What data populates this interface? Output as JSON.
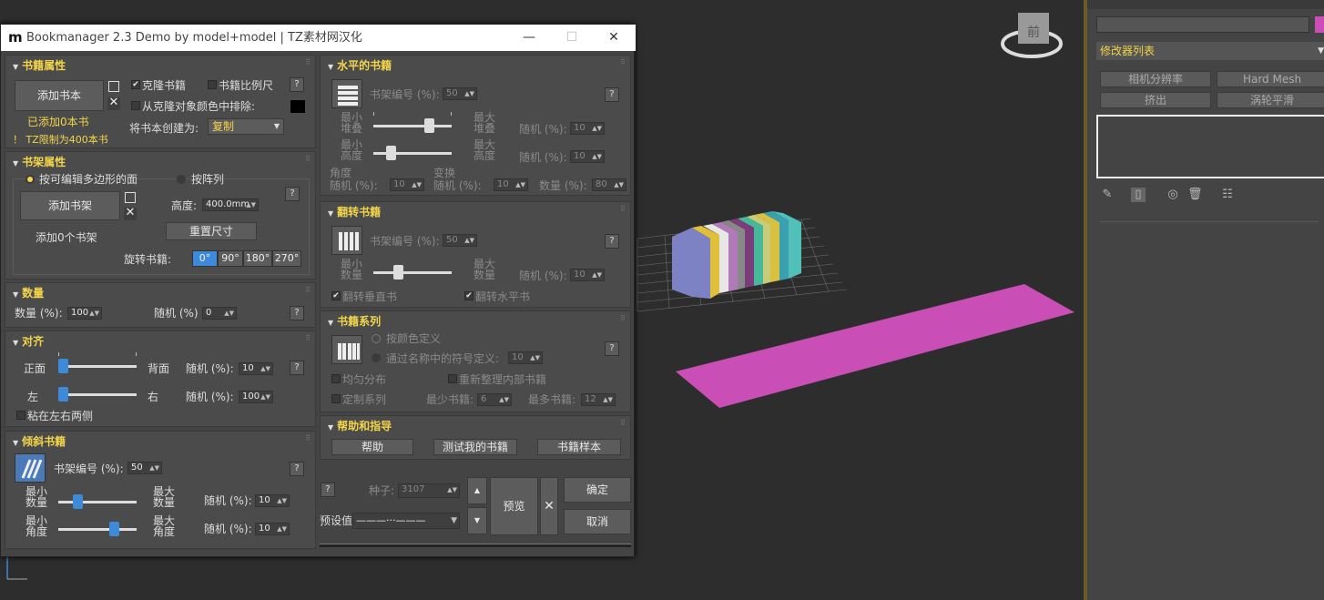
{
  "viewport": {
    "cube_label": "前",
    "plane_color": "#c94fb6"
  },
  "right_panel": {
    "modifier_list": "修改器列表",
    "buttons": [
      "相机分辨率",
      "Hard Mesh",
      "挤出",
      "涡轮平滑"
    ]
  },
  "dialog": {
    "app_icon": "m",
    "title": "Bookmanager 2.3 Demo by model+model | TZ素材网汉化",
    "book_props": {
      "title": "书籍属性",
      "add_book": "添加书本",
      "added": "已添加0本书",
      "limit": "！ TZ限制为400本书",
      "clone": "克隆书籍",
      "proportional": "书籍比例尺",
      "exclude_color": "从克隆对象颜色中排除:",
      "create_as_label": "将书本创建为:",
      "create_as_value": "复制",
      "q": "?"
    },
    "shelf_props": {
      "title": "书架属性",
      "by_poly": "按可编辑多边形的面",
      "by_array": "按阵列",
      "add_shelf": "添加书架",
      "added": "添加0个书架",
      "height_label": "高度:",
      "height_value": "400.0mm",
      "reset": "重置尺寸",
      "rotate_label": "旋转书籍:",
      "degrees": [
        "0°",
        "90°",
        "180°",
        "270°"
      ],
      "q": "?"
    },
    "quantity": {
      "title": "数量",
      "qty_label": "数量 (%):",
      "qty_value": "100",
      "rand_label": "随机 (%)",
      "rand_value": "0",
      "q": "?"
    },
    "align": {
      "title": "对齐",
      "front": "正面",
      "back": "背面",
      "left": "左",
      "right": "右",
      "rand1_label": "随机 (%):",
      "rand1_value": "10",
      "rand2_label": "随机 (%):",
      "rand2_value": "100",
      "stick": "粘在左右两侧",
      "q": "?"
    },
    "tilt": {
      "title": "倾斜书籍",
      "shelf_no_label": "书架编号 (%):",
      "shelf_no_value": "50",
      "min_qty": [
        "最小",
        "数量"
      ],
      "max_qty": [
        "最大",
        "数量"
      ],
      "min_angle": [
        "最小",
        "角度"
      ],
      "max_angle": [
        "最大",
        "角度"
      ],
      "rand_label": "随机 (%):",
      "rand1_value": "10",
      "rand2_value": "10",
      "q": "?"
    },
    "horizontal": {
      "title": "水平的书籍",
      "shelf_no_label": "书架编号 (%):",
      "shelf_no_value": "50",
      "min_stack": [
        "最小",
        "堆叠"
      ],
      "max_stack": [
        "最大",
        "堆叠"
      ],
      "min_height": [
        "最小",
        "高度"
      ],
      "max_height": [
        "最大",
        "高度"
      ],
      "rand_label": "随机 (%):",
      "rand1_value": "10",
      "rand2_value": "10",
      "angle_label": [
        "角度",
        "随机 (%):"
      ],
      "angle_value": "10",
      "swap_label": [
        "变换",
        "随机 (%):"
      ],
      "swap_value": "10",
      "count_label": "数量 (%):",
      "count_value": "80",
      "q": "?"
    },
    "flip": {
      "title": "翻转书籍",
      "shelf_no_label": "书架编号 (%):",
      "shelf_no_value": "50",
      "min_qty": [
        "最小",
        "数量"
      ],
      "max_qty": [
        "最大",
        "数量"
      ],
      "rand_label": "随机 (%):",
      "rand_value": "10",
      "flip_vertical": "翻转垂直书",
      "flip_horizontal": "翻转水平书",
      "q": "?"
    },
    "series": {
      "title": "书籍系列",
      "by_color": "按颜色定义",
      "by_symbol": "通过名称中的符号定义:",
      "symbol_value": "10",
      "even": "均匀分布",
      "reorganize": "重新整理内部书籍",
      "custom": "定制系列",
      "min_label": "最少书籍:",
      "min_value": "6",
      "max_label": "最多书籍:",
      "max_value": "12",
      "q": "?"
    },
    "help": {
      "title": "帮助和指导",
      "help": "帮助",
      "test": "测试我的书籍",
      "sample": "书籍样本"
    },
    "bottom": {
      "q": "?",
      "seed_label": "种子:",
      "seed_value": "3107",
      "preset_label": "预设值",
      "preset_value": "———···———",
      "preview": "预览",
      "ok": "确定",
      "cancel": "取消"
    }
  }
}
